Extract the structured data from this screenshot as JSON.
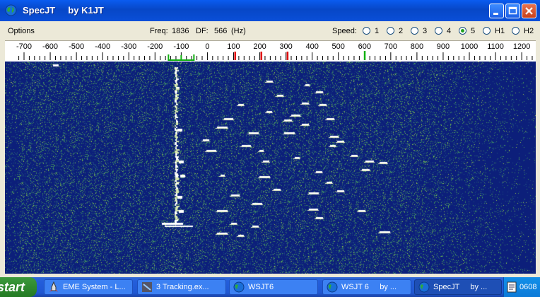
{
  "window": {
    "title": "SpecJT     by K1JT",
    "icon": "globe-icon",
    "controls": [
      "minimize-icon",
      "maximize-icon",
      "close-icon"
    ]
  },
  "menubar": {
    "options_label": "Options",
    "freq_label": "Freq:",
    "freq_value": "1836",
    "df_label": "DF:",
    "df_value": "566",
    "df_unit": "(Hz)",
    "speed_label": "Speed:",
    "speed_options": [
      "1",
      "2",
      "3",
      "4",
      "5",
      "H1",
      "H2"
    ],
    "speed_selected": "5"
  },
  "scale": {
    "labels": [
      "-700",
      "-600",
      "-500",
      "-400",
      "-300",
      "-200",
      "-100",
      "0",
      "100",
      "200",
      "300",
      "400",
      "500",
      "600",
      "700",
      "800",
      "900",
      "1000",
      "1100",
      "1200"
    ],
    "green_marker": "600",
    "red_markers": [
      "100",
      "200",
      "300"
    ],
    "green_bracket": "-100"
  },
  "colors": {
    "waterfall_bg": "#0c1f7a",
    "signal": "#ffffff",
    "noise": "#4ea85a",
    "marker_red": "#e00000",
    "marker_green": "#10b010"
  },
  "taskbar": {
    "start_label": "start",
    "tasks": [
      {
        "label": "EME System - L...",
        "icon": "rocket-icon",
        "active": false
      },
      {
        "label": "3 Tracking.ex...",
        "icon": "dish-icon",
        "active": false
      },
      {
        "label": "WSJT6",
        "icon": "globe-icon",
        "active": false
      },
      {
        "label": "WSJT 6     by ...",
        "icon": "globe-icon",
        "active": false
      },
      {
        "label": "SpecJT     by ...",
        "icon": "globe-icon",
        "active": true
      }
    ],
    "tray_text": "0608"
  }
}
